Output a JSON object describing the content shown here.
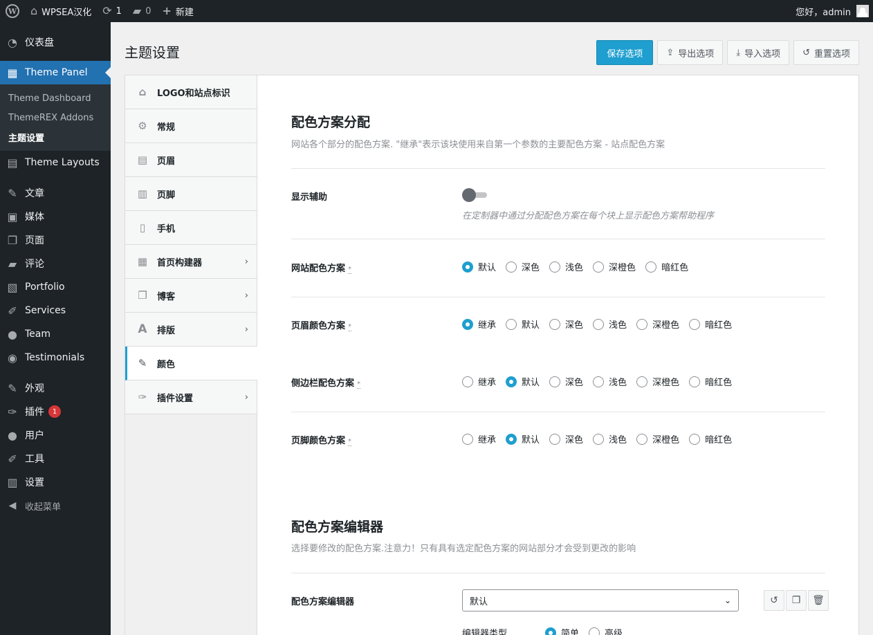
{
  "adminbar": {
    "wp_logo": "W",
    "site_name": "WPSEA汉化",
    "updates_count": "1",
    "comments_count": "0",
    "new_label": "新建",
    "greeting": "您好，admin"
  },
  "sidebar": {
    "dashboard": "仪表盘",
    "theme_panel": "Theme Panel",
    "sub_items": [
      "Theme Dashboard",
      "ThemeREX Addons",
      "主题设置"
    ],
    "theme_layouts": "Theme Layouts",
    "posts": "文章",
    "media": "媒体",
    "pages": "页面",
    "comments": "评论",
    "portfolio": "Portfolio",
    "services": "Services",
    "team": "Team",
    "testimonials": "Testimonials",
    "appearance": "外观",
    "plugins": "插件",
    "plugins_badge": "1",
    "users": "用户",
    "tools": "工具",
    "settings": "设置",
    "collapse": "收起菜单"
  },
  "page": {
    "title": "主题设置",
    "buttons": {
      "save": "保存选项",
      "export": "导出选项",
      "import": "导入选项",
      "reset": "重置选项"
    }
  },
  "tabs": [
    {
      "label": "LOGO和站点标识",
      "icon": "home-icon"
    },
    {
      "label": "常规",
      "icon": "gear-icon"
    },
    {
      "label": "页眉",
      "icon": "header-icon"
    },
    {
      "label": "页脚",
      "icon": "footer-icon"
    },
    {
      "label": "手机",
      "icon": "mobile-icon"
    },
    {
      "label": "首页构建器",
      "icon": "grid-icon"
    },
    {
      "label": "博客",
      "icon": "blog-icon"
    },
    {
      "label": "排版",
      "icon": "typography-icon"
    },
    {
      "label": "颜色",
      "icon": "brush-icon"
    },
    {
      "label": "插件设置",
      "icon": "plugin-icon"
    }
  ],
  "scheme_assign": {
    "title": "配色方案分配",
    "desc": "网站各个部分的配色方案. \"继承\"表示该块使用来自第一个参数的主要配色方案 - 站点配色方案",
    "show_helper_label": "显示辅助",
    "show_helper_hint": "在定制器中通过分配配色方案在每个块上显示配色方案帮助程序",
    "required_mark": "*",
    "rows": [
      {
        "label": "网站配色方案",
        "options": [
          "默认",
          "深色",
          "浅色",
          "深橙色",
          "暗红色"
        ],
        "selected": "默认"
      },
      {
        "label": "页眉颜色方案",
        "options": [
          "继承",
          "默认",
          "深色",
          "浅色",
          "深橙色",
          "暗红色"
        ],
        "selected": "继承"
      },
      {
        "label": "侧边栏配色方案",
        "options": [
          "继承",
          "默认",
          "深色",
          "浅色",
          "深橙色",
          "暗红色"
        ],
        "selected": "默认"
      },
      {
        "label": "页脚颜色方案",
        "options": [
          "继承",
          "默认",
          "深色",
          "浅色",
          "深橙色",
          "暗红色"
        ],
        "selected": "默认"
      }
    ]
  },
  "scheme_editor": {
    "title": "配色方案编辑器",
    "desc": "选择要修改的配色方案.注意力！只有具有选定配色方案的网站部分才会受到更改的影响",
    "editor_label": "配色方案编辑器",
    "editor_value": "默认",
    "editor_type_label": "编辑器类型",
    "editor_type_options": [
      "简单",
      "高级"
    ],
    "editor_type_selected": "简单"
  },
  "colors": {
    "accent": "#1e9fcf",
    "wp_blue": "#2271b1",
    "sidebar_bg": "#1d2327"
  }
}
